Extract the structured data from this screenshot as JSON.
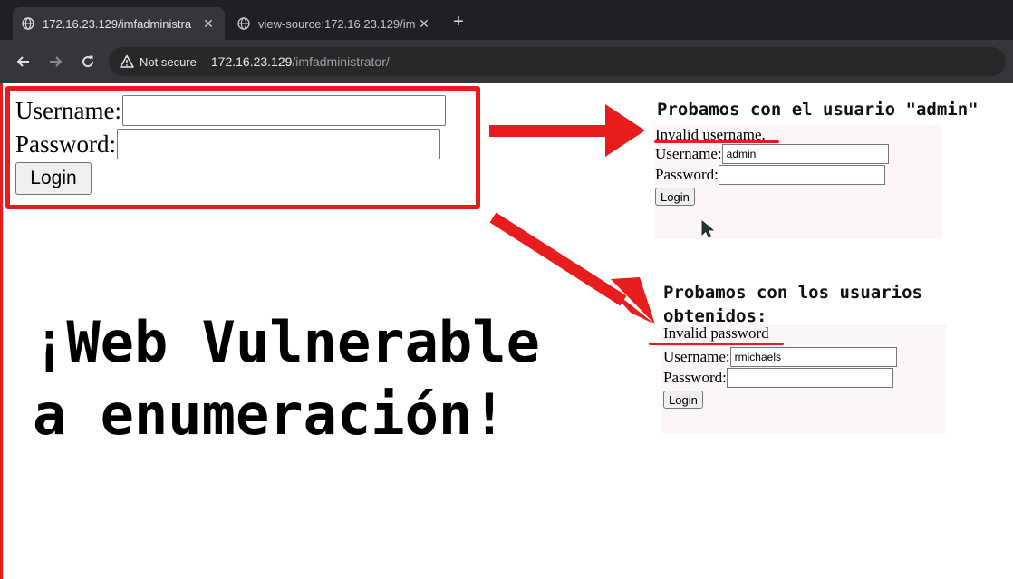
{
  "browser": {
    "tabs": [
      {
        "title": "172.16.23.129/imfadministra",
        "close": "✕"
      },
      {
        "title": "view-source:172.16.23.129/im",
        "close": "✕"
      }
    ],
    "new_tab": "+",
    "security_label": "Not secure",
    "url_host": "172.16.23.129",
    "url_path": "/imfadministrator/"
  },
  "login_form": {
    "username_label": "Username:",
    "password_label": "Password:",
    "login_button": "Login"
  },
  "test_admin": {
    "heading": "Probamos con el usuario \"admin\"",
    "message": "Invalid username.",
    "username_label": "Username:",
    "username_value": "admin",
    "password_label": "Password:",
    "login_button": "Login"
  },
  "test_users": {
    "heading": "Probamos con los usuarios obtenidos:",
    "message": "Invalid password",
    "username_label": "Username:",
    "username_value": "rmichaels",
    "password_label": "Password:",
    "login_button": "Login"
  },
  "banner": {
    "line1": "¡Web Vulnerable",
    "line2": "a enumeración!"
  },
  "colors": {
    "accent_red": "#e81c1c",
    "chrome_dark": "#1f2024",
    "toolbar": "#35363a"
  }
}
